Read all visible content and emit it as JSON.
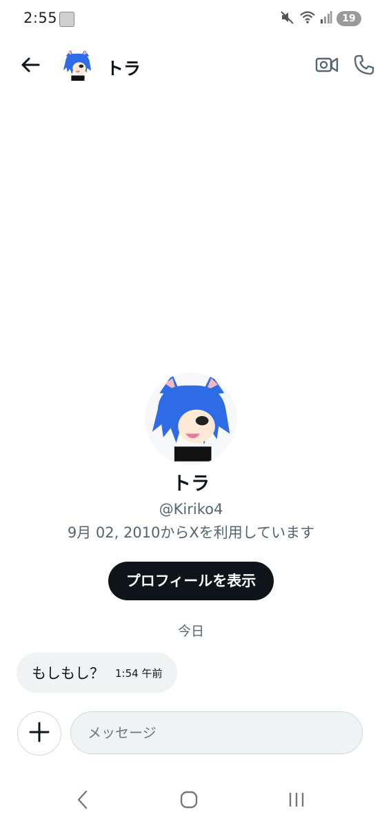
{
  "status_bar": {
    "time": "2:55",
    "battery_level": "19",
    "icons": [
      "notification-thumbnail-icon",
      "mute-icon",
      "wifi-icon",
      "signal-icon",
      "battery-icon"
    ]
  },
  "header": {
    "title": "トラ",
    "icons": [
      "back-arrow-icon",
      "avatar",
      "video-call-icon",
      "phone-icon"
    ]
  },
  "profile": {
    "name": "トラ",
    "handle": "@Kiriko4",
    "joined": "9月 02, 2010からXを利用しています",
    "button_label": "プロフィールを表示"
  },
  "conversation": {
    "date_divider": "今日",
    "messages": [
      {
        "text": "もしもし？",
        "time": "1:54 午前",
        "direction": "received"
      }
    ]
  },
  "composer": {
    "placeholder": "メッセージ",
    "value": ""
  },
  "nav_bar": {
    "icons": [
      "nav-back-icon",
      "nav-home-icon",
      "nav-recents-icon"
    ]
  },
  "colors": {
    "text_primary": "#0f1419",
    "text_secondary": "#536471",
    "bubble_bg": "#eff3f4",
    "button_bg": "#0f1419",
    "avatar_hair": "#2e6be6"
  }
}
